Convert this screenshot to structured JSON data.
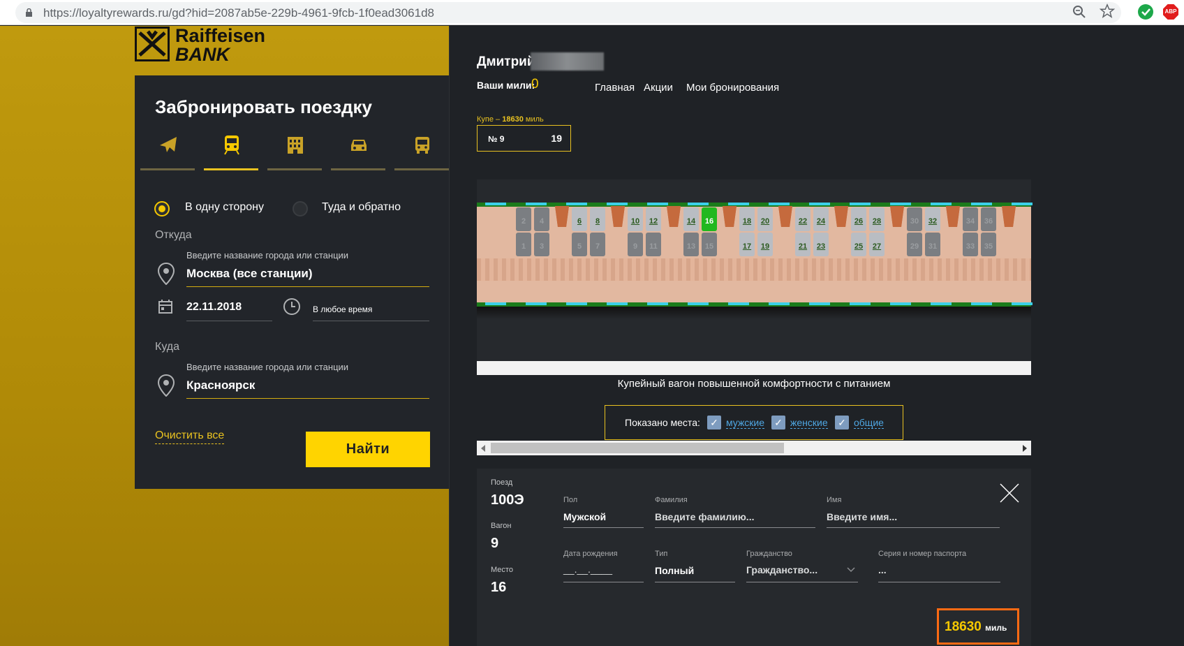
{
  "browser": {
    "url": "https://loyaltyrewards.ru/gd?hid=2087ab5e-229b-4961-9fcb-1f0ead3061d8",
    "abp_label": "ABP"
  },
  "logo": {
    "line1": "Raiffeisen",
    "line2": "BANK"
  },
  "booking": {
    "title": "Забронировать поездку",
    "tabs": [
      "plane-icon",
      "train-icon",
      "hotel-icon",
      "car-icon",
      "bus-icon"
    ],
    "trip_one_way": "В одну сторону",
    "trip_round": "Туда и обратно",
    "from_label": "Откуда",
    "from_hint": "Введите название города или станции",
    "from_value": "Москва (все станции)",
    "date_value": "22.11.2018",
    "time_value": "В любое время",
    "to_label": "Куда",
    "to_hint": "Введите название города или станции",
    "to_value": "Красноярск",
    "clear_label": "Очистить все",
    "find_label": "Найти"
  },
  "header": {
    "user_name": "Дмитрий",
    "miles_label": "Ваши мили:",
    "miles_value": "0",
    "nav": [
      "Главная",
      "Акции",
      "Мои бронирования"
    ]
  },
  "wagon": {
    "coupe_label": "Купе –",
    "coupe_price": "18630",
    "coupe_unit": "миль",
    "number": "№ 9",
    "seats_count": "19",
    "description": "Купейный вагон повышенной комфортности с питанием",
    "filter_label": "Показано места:",
    "filters": [
      "мужские",
      "женские",
      "общие"
    ],
    "upper_seats": [
      {
        "n": "2",
        "s": "busy"
      },
      {
        "n": "4",
        "s": "busy"
      },
      {
        "n": "6",
        "s": "free"
      },
      {
        "n": "8",
        "s": "free"
      },
      {
        "n": "10",
        "s": "free"
      },
      {
        "n": "12",
        "s": "free"
      },
      {
        "n": "14",
        "s": "free"
      },
      {
        "n": "16",
        "s": "sel"
      },
      {
        "n": "18",
        "s": "free"
      },
      {
        "n": "20",
        "s": "free"
      },
      {
        "n": "22",
        "s": "free"
      },
      {
        "n": "24",
        "s": "free"
      },
      {
        "n": "26",
        "s": "free"
      },
      {
        "n": "28",
        "s": "free"
      },
      {
        "n": "30",
        "s": "busy"
      },
      {
        "n": "32",
        "s": "free"
      },
      {
        "n": "34",
        "s": "busy"
      },
      {
        "n": "36",
        "s": "busy"
      }
    ],
    "lower_seats": [
      {
        "n": "1",
        "s": "busy"
      },
      {
        "n": "3",
        "s": "busy"
      },
      {
        "n": "5",
        "s": "busy"
      },
      {
        "n": "7",
        "s": "busy"
      },
      {
        "n": "9",
        "s": "busy"
      },
      {
        "n": "11",
        "s": "busy"
      },
      {
        "n": "13",
        "s": "busy"
      },
      {
        "n": "15",
        "s": "busy"
      },
      {
        "n": "17",
        "s": "free"
      },
      {
        "n": "19",
        "s": "free"
      },
      {
        "n": "21",
        "s": "free"
      },
      {
        "n": "23",
        "s": "free"
      },
      {
        "n": "25",
        "s": "free"
      },
      {
        "n": "27",
        "s": "free"
      },
      {
        "n": "29",
        "s": "busy"
      },
      {
        "n": "31",
        "s": "busy"
      },
      {
        "n": "33",
        "s": "busy"
      },
      {
        "n": "35",
        "s": "busy"
      }
    ]
  },
  "passenger": {
    "train_label": "Поезд",
    "train_value": "100Э",
    "wagon_label": "Вагон",
    "wagon_value": "9",
    "seat_label": "Место",
    "seat_value": "16",
    "gender_label": "Пол",
    "gender_value": "Мужской",
    "surname_label": "Фамилия",
    "surname_placeholder": "Введите фамилию...",
    "name_label": "Имя",
    "name_placeholder": "Введите имя...",
    "birth_label": "Дата рождения",
    "birth_placeholder": "__.__.____",
    "type_label": "Тип",
    "type_value": "Полный",
    "citizenship_label": "Гражданство",
    "citizenship_placeholder": "Гражданство...",
    "passport_label": "Серия и номер паспорта",
    "passport_placeholder": "...",
    "price_value": "18630",
    "price_unit": "миль"
  }
}
